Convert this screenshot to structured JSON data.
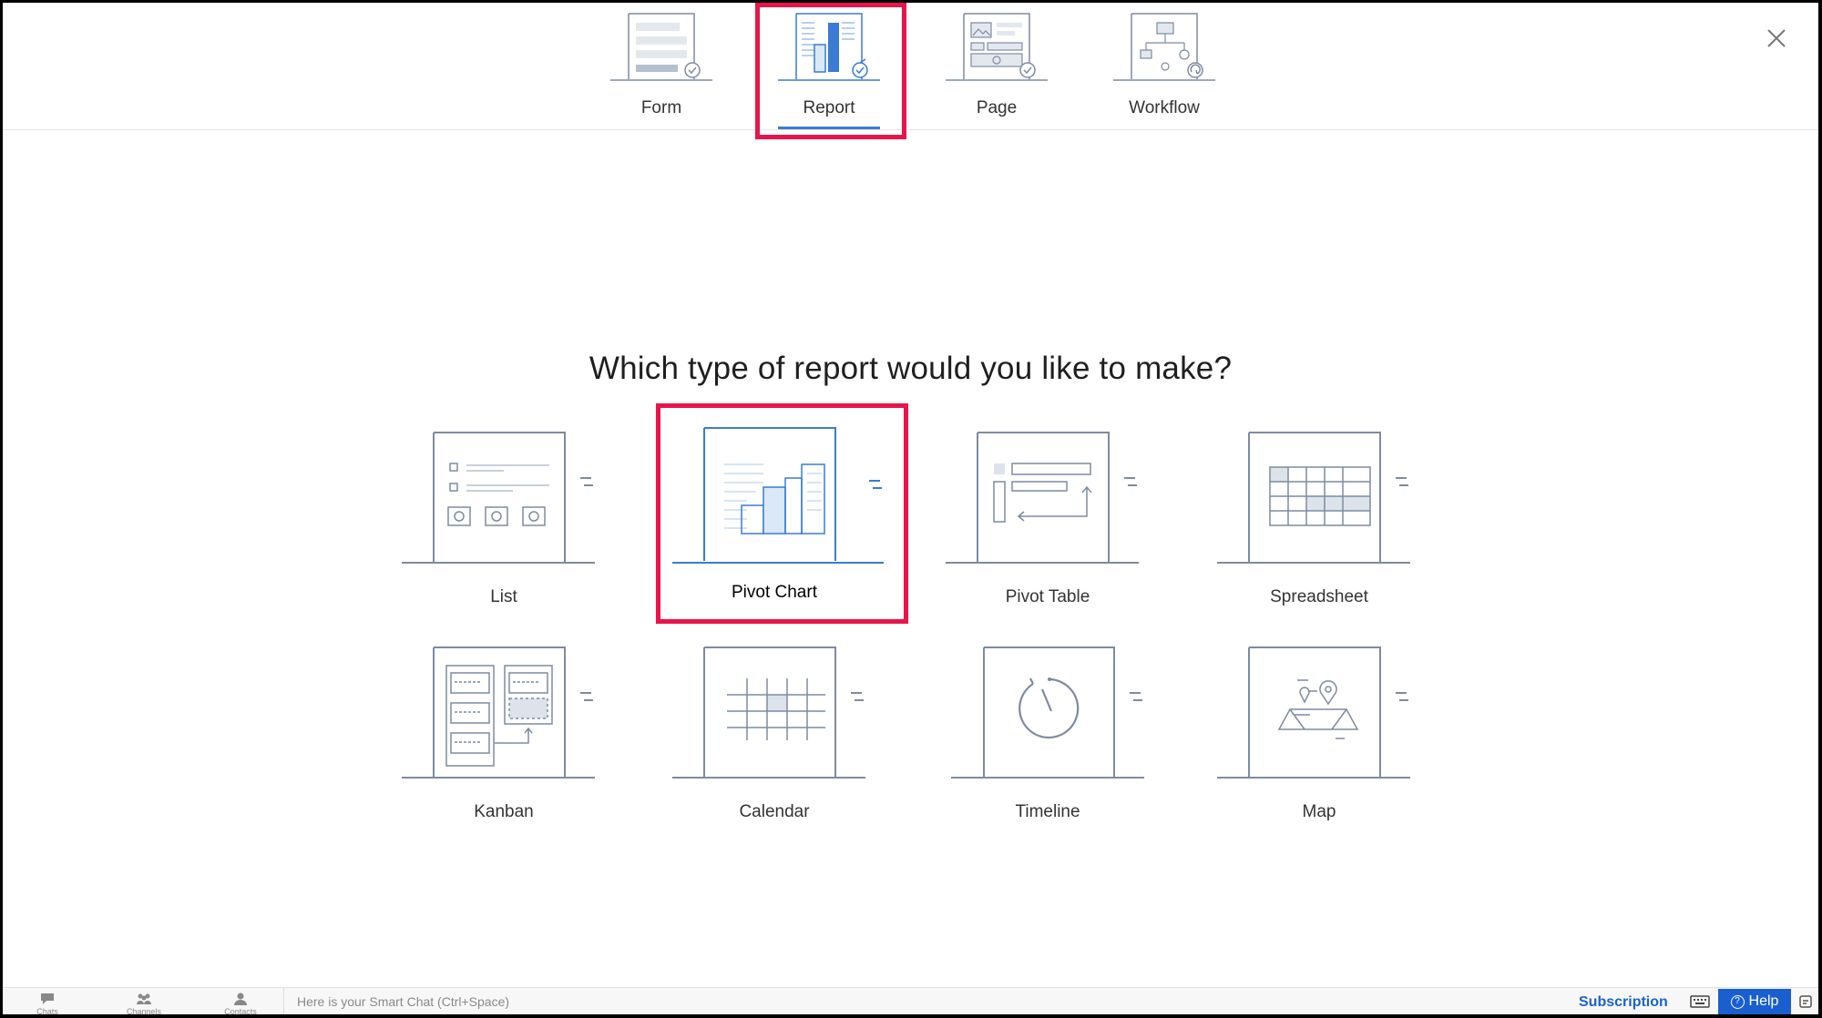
{
  "top_tabs": [
    {
      "label": "Form",
      "icon": "form-icon"
    },
    {
      "label": "Report",
      "icon": "report-icon",
      "selected": true
    },
    {
      "label": "Page",
      "icon": "page-icon"
    },
    {
      "label": "Workflow",
      "icon": "workflow-icon"
    }
  ],
  "close_icon": "close-icon",
  "question": "Which type of report would you like to make?",
  "report_types": [
    {
      "label": "List",
      "icon": "list-icon"
    },
    {
      "label": "Pivot Chart",
      "icon": "pivot-chart-icon",
      "selected": true
    },
    {
      "label": "Pivot Table",
      "icon": "pivot-table-icon"
    },
    {
      "label": "Spreadsheet",
      "icon": "spreadsheet-icon"
    },
    {
      "label": "Kanban",
      "icon": "kanban-icon"
    },
    {
      "label": "Calendar",
      "icon": "calendar-icon"
    },
    {
      "label": "Timeline",
      "icon": "timeline-icon"
    },
    {
      "label": "Map",
      "icon": "map-icon"
    }
  ],
  "bottom_bar": {
    "chats": "Chats",
    "channels": "Channels",
    "contacts": "Contacts",
    "smart_chat_placeholder": "Here is your Smart Chat (Ctrl+Space)",
    "subscription": "Subscription",
    "help": "Help"
  },
  "colors": {
    "accent": "#3a7bd5",
    "highlight": "#e8144b",
    "line": "#7d8ba0",
    "help_bg": "#1a5fd0"
  }
}
